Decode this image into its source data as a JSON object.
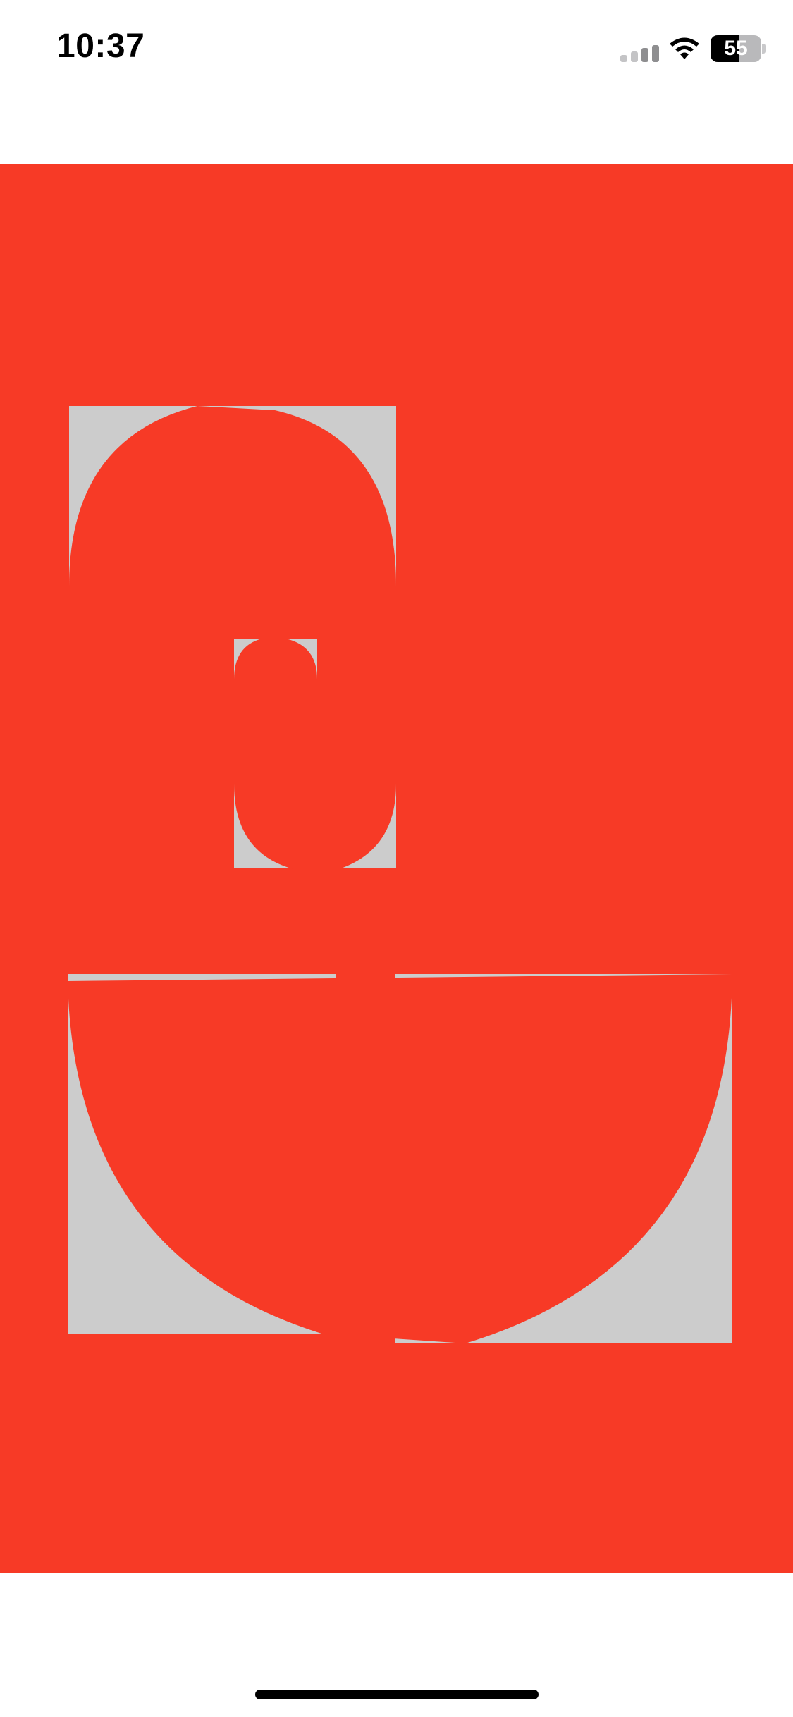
{
  "status_bar": {
    "time": "10:37",
    "battery_percent": 55,
    "battery_label": "55",
    "cellular_icon": "cellular-signal-icon",
    "wifi_icon": "wifi-icon",
    "battery_icon": "battery-icon"
  },
  "canvas": {
    "background_color": "#f73a26",
    "shape_fill": "#f73a26",
    "tile_color": "#cccccc"
  },
  "home_indicator": {
    "color": "#000000"
  }
}
